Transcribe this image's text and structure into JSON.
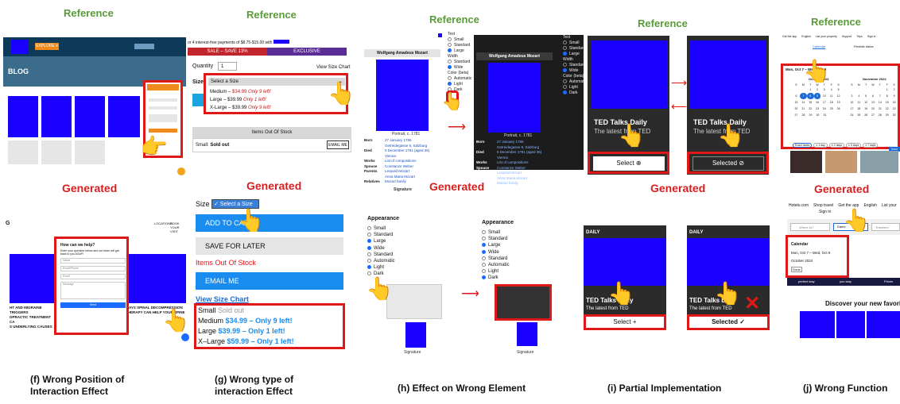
{
  "panel_labels": {
    "reference": "Reference",
    "generated": "Generated"
  },
  "captions": {
    "f": [
      "(f) Wrong Position of",
      "Interaction Effect"
    ],
    "g": [
      "(g) Wrong type of",
      "interaction Effect"
    ],
    "h": "(h) Effect on Wrong Element",
    "i": "(i) Partial Implementation",
    "j": "(j) Wrong Function"
  },
  "f": {
    "ref_button": "EXPLORE ▾",
    "ref_blog": "BLOG",
    "gen_nav": [
      "LOCATIONS",
      "BOOK YOUR VISIT"
    ],
    "gen_popup_title": "How can we help?",
    "gen_popup_sub": "Enter your question below and our team will get back to you ASAP!",
    "gen_fields": [
      "Name",
      "Email/Phone",
      "Email",
      "Message"
    ],
    "gen_send": "Send",
    "gen_headlines": [
      "HT AND MIGRAINE TRIGGERS",
      "OPRACTIC TREATMENT CA",
      "S UNDERLYING CAUSES",
      "WAYS SPINAL DECOMPRESSION",
      "THERAPY CAN HELP YOUR SPINE"
    ]
  },
  "g": {
    "ref_promo": "or 4 interest-free payments of $8.75-$15.00 with",
    "ref_sale": "SALE – SAVE 13%",
    "ref_exclusive": "EXCLUSIVE",
    "ref_quantity_label": "Quantity",
    "ref_quantity": "1",
    "ref_view_size": "View Size Chart",
    "ref_size_label": "Size",
    "ref_select": "Select a Size",
    "ref_options": [
      {
        "name": "Medium – ",
        "price": "$34.99",
        "note": " Only 9 left!"
      },
      {
        "name": "Large – $39.99 ",
        "price": "",
        "note": "Only 1 left!"
      },
      {
        "name": "X-Large – $39.99 ",
        "price": "",
        "note": "Only 9 left!"
      }
    ],
    "ref_out_of_stock": "Items Out Of Stock",
    "ref_small": "Small: ",
    "ref_sold_out": "Sold out",
    "ref_email": "EMAIL ME",
    "gen_size_label": "Size",
    "gen_select": "✓ Select a Size",
    "gen_add": "ADD TO CART",
    "gen_save": "SAVE FOR LATER",
    "gen_out_of_stock": "Items Out Of Stock",
    "gen_email": "EMAIL ME",
    "gen_view_size": "View Size Chart",
    "gen_small": "Small",
    "gen_sold_out": "Sold out",
    "gen_options": [
      {
        "name": "Medium",
        "price": "$34.99 – Only 9 left!"
      },
      {
        "name": "Large",
        "price": "$39.99 – Only 1 left!"
      },
      {
        "name": "X–Large",
        "price": "$59.99 – Only 1 left!"
      }
    ]
  },
  "h": {
    "ref_title": "Wolfgang Amadeus Mozart",
    "ref_portrait": "Portrait, c. 1781",
    "ref_rows": [
      {
        "k": "Born",
        "v": "27 January 1756"
      },
      {
        "k": "",
        "v": "Getreidegasse 9, Salzburg"
      },
      {
        "k": "Died",
        "v": "5 December 1791 (aged 35)"
      },
      {
        "k": "",
        "v": "Vienna"
      },
      {
        "k": "Works",
        "v": "List of compositions"
      },
      {
        "k": "Spouse",
        "v": "Constanze Weber"
      },
      {
        "k": "Parents",
        "v": "Leopold Mozart"
      },
      {
        "k": "",
        "v": "Anna Maria Mozart"
      },
      {
        "k": "Relatives",
        "v": "Mozart family"
      }
    ],
    "ref_signature": "Signature",
    "ref_side": [
      "Text",
      "Small",
      "Standard",
      "Large",
      "Width",
      "Standard",
      "Wide",
      "Color (beta)",
      "Automatic",
      "Light",
      "Dark"
    ],
    "gen_title": "Appearance",
    "gen_options": [
      "Small",
      "Standard",
      "Large",
      "Wide",
      "Standard",
      "Automatic",
      "Light",
      "Dark"
    ],
    "gen_signature": "Signature"
  },
  "i": {
    "ref_title": "TED Talks Daily",
    "ref_sub": "The latest from TED",
    "ref_select": "Select ⊕",
    "ref_selected": "Selected ⊘",
    "gen_header": "DAILY",
    "gen_title": "TED Talks Daily",
    "gen_sub": "The latest from TED",
    "gen_select": "Select +",
    "gen_selected": "Selected ✓"
  },
  "j": {
    "ref_tabs": [
      "Get the app",
      "English",
      "List your property",
      "Support",
      "Trips",
      "Sign in"
    ],
    "ref_cal_tabs": [
      "Calendar",
      "Flexible dates"
    ],
    "ref_range": "Mon, Oct 7 – Wed, Oct 9",
    "ref_months": [
      "October 2024",
      "November 2024"
    ],
    "ref_dow": [
      "S",
      "M",
      "T",
      "W",
      "T",
      "F",
      "S"
    ],
    "ref_chips": [
      "Exact dates",
      "± 1 day",
      "± 2 days",
      "± 3 days",
      "± 7 days"
    ],
    "ref_done": "Done",
    "gen_nav": [
      "Hotels.com",
      "Shop travel",
      "Get the app",
      "English",
      "List your"
    ],
    "gen_signin": "Sign in",
    "gen_where": "Where to?",
    "gen_dates": "Dates",
    "gen_travelers": "Travelers",
    "gen_cal_title": "Calendar",
    "gen_range": "Mon, Oct 7 – Wed, Oct 9",
    "gen_month": "October 2024",
    "gen_done": "Done",
    "gen_strip": [
      "perfect stay",
      "you stay",
      "Prices"
    ],
    "gen_discover": "Discover your new favorit"
  }
}
